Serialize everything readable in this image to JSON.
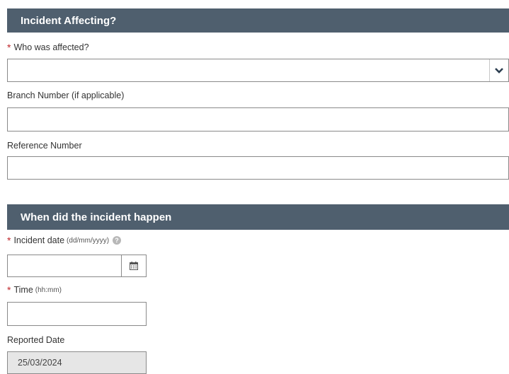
{
  "section1": {
    "title": "Incident Affecting?",
    "who_label": "Who was affected?",
    "who_value": "",
    "branch_label": "Branch Number (if applicable)",
    "branch_value": "",
    "reference_label": "Reference Number",
    "reference_value": ""
  },
  "section2": {
    "title": "When did the incident happen",
    "date_label": "Incident date",
    "date_hint": "(dd/mm/yyyy)",
    "date_value": "",
    "time_label": "Time",
    "time_hint": "(hh:mm)",
    "time_value": "",
    "reported_label": "Reported Date",
    "reported_value": "25/03/2024"
  },
  "icons": {
    "required": "required-asterisk",
    "dropdown": "chevron-down-icon",
    "calendar": "calendar-icon",
    "help": "help-icon"
  },
  "colors": {
    "header_bg": "#4f5f6e",
    "required": "#c0282d",
    "readonly_bg": "#e6e6e6"
  }
}
